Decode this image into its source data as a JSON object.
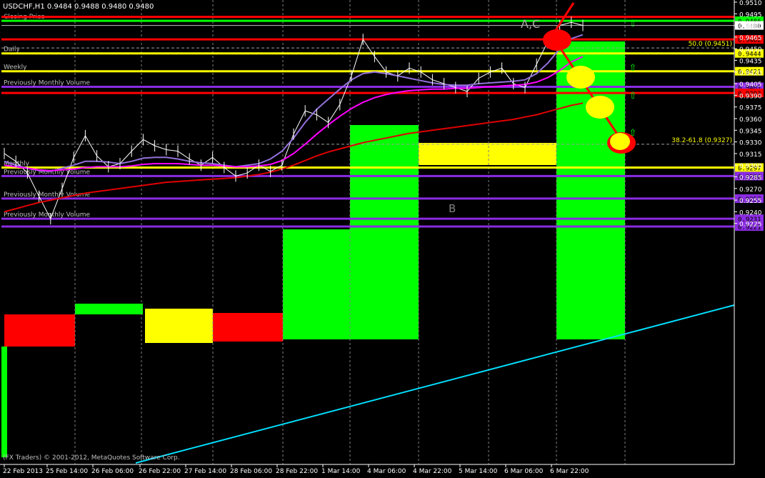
{
  "chart_data": {
    "type": "line",
    "title": "USDCHF,H1  0.9484 0.9488 0.9480 0.9480",
    "ylim": [
      0.921,
      0.951
    ],
    "y_ticks": [
      "0.9510",
      "0.9495",
      "0.9480",
      "0.9465",
      "0.9450",
      "0.9435",
      "0.9420",
      "0.9405",
      "0.9390",
      "0.9375",
      "0.9360",
      "0.9345",
      "0.9330",
      "0.9315",
      "0.9300",
      "0.9285",
      "0.9270",
      "0.9255",
      "0.9240",
      "0.9225"
    ],
    "x_ticks": [
      "22 Feb 2013",
      "25 Feb 14:00",
      "26 Feb 06:00",
      "26 Feb 22:00",
      "27 Feb 14:00",
      "28 Feb 06:00",
      "28 Feb 22:00",
      "1 Mar 14:00",
      "4 Mar 06:00",
      "4 Mar 22:00",
      "5 Mar 14:00",
      "6 Mar 06:00",
      "6 Mar 22:00"
    ],
    "horizontal_levels": [
      {
        "name": "Closing Price",
        "value": 0.9486,
        "label": "0.9486",
        "color": "#00ff00"
      },
      {
        "name": "",
        "value": 0.9491,
        "label": "",
        "color": "#ff0000"
      },
      {
        "name": "",
        "value": 0.948,
        "label": "0.9480",
        "color": "#c0c0c0"
      },
      {
        "name": "",
        "value": 0.9462,
        "label": "0.9462",
        "color": "#ff0000"
      },
      {
        "name": "Daily",
        "value": 0.9444,
        "label": "0.9444",
        "color": "#ffff00"
      },
      {
        "name": "Weekly",
        "value": 0.9421,
        "label": "0.9421",
        "color": "#ffff00"
      },
      {
        "name": "Previously Monthly Volume",
        "value": 0.9401,
        "label": "0.9401",
        "color": "#8a2be2"
      },
      {
        "name": "",
        "value": 0.9393,
        "label": "0.9393",
        "color": "#ff0000"
      },
      {
        "name": "Monthly",
        "value": 0.9297,
        "label": "0.9297",
        "color": "#ffff00"
      },
      {
        "name": "Previously Monthly Volume",
        "value": 0.9286,
        "label": "0.9286",
        "color": "#8a2be2"
      },
      {
        "name": "Previously Monthly Volume",
        "value": 0.9257,
        "label": "0.9257",
        "color": "#8a2be2"
      },
      {
        "name": "Previously Monthly Volume",
        "value": 0.9231,
        "label": "0.9231",
        "color": "#8a2be2"
      },
      {
        "name": "",
        "value": 0.9221,
        "label": "0.9221",
        "color": "#8a2be2"
      }
    ],
    "fib_levels": [
      {
        "label": "50.0 (0.9451)",
        "value": 0.9451
      },
      {
        "label": "38.2-61.8 (0.9327)",
        "value": 0.9327
      }
    ],
    "annotations": [
      "A,C",
      "B"
    ],
    "copyright": "(FX Traders) © 2001-2012, MetaQuotes Software Corp.",
    "series": [
      {
        "name": "",
        "color": "#ffffff",
        "values": [
          0.9315,
          0.9305,
          0.929,
          0.926,
          0.9231,
          0.927,
          0.931,
          0.9338,
          0.9312,
          0.9298,
          0.9302,
          0.9318,
          0.9333,
          0.9325,
          0.932,
          0.9318,
          0.9308,
          0.93,
          0.931,
          0.9297,
          0.9286,
          0.929,
          0.93,
          0.9292,
          0.93,
          0.934,
          0.937,
          0.9365,
          0.9355,
          0.9378,
          0.9415,
          0.9462,
          0.944,
          0.942,
          0.9415,
          0.9425,
          0.942,
          0.941,
          0.9405,
          0.94,
          0.9395,
          0.9412,
          0.942,
          0.9425,
          0.9405,
          0.94,
          0.943,
          0.946,
          0.948,
          0.9484,
          0.948
        ]
      },
      {
        "name": "",
        "color": "#9370db",
        "values": [
          0.9305,
          0.93,
          0.9296,
          0.9293,
          0.9292,
          0.9296,
          0.93,
          0.9305,
          0.9305,
          0.9304,
          0.9302,
          0.9305,
          0.9309,
          0.931,
          0.931,
          0.9308,
          0.9305,
          0.9303,
          0.9302,
          0.93,
          0.9298,
          0.93,
          0.9302,
          0.9308,
          0.9318,
          0.9335,
          0.9355,
          0.9372,
          0.9385,
          0.9398,
          0.941,
          0.9418,
          0.942,
          0.9418,
          0.9415,
          0.9412,
          0.9409,
          0.9406,
          0.9404,
          0.9403,
          0.9403,
          0.9405,
          0.9406,
          0.9407,
          0.9408,
          0.941,
          0.9418,
          0.9432,
          0.945,
          0.9463,
          0.9468
        ]
      },
      {
        "name": "",
        "color": "#ff00ff",
        "values": [
          0.93,
          0.9298,
          0.9296,
          0.9294,
          0.9293,
          0.9294,
          0.9295,
          0.9297,
          0.9298,
          0.9298,
          0.9298,
          0.9299,
          0.9301,
          0.9302,
          0.9302,
          0.9302,
          0.9301,
          0.93,
          0.93,
          0.9299,
          0.9298,
          0.9298,
          0.9299,
          0.9301,
          0.9306,
          0.9315,
          0.9327,
          0.934,
          0.9352,
          0.9363,
          0.9373,
          0.9381,
          0.9387,
          0.9391,
          0.9394,
          0.9396,
          0.9397,
          0.9398,
          0.9398,
          0.9399,
          0.9399,
          0.94,
          0.9401,
          0.9402,
          0.9403,
          0.9404,
          0.9407,
          0.9413,
          0.9422,
          0.9433,
          0.944
        ]
      },
      {
        "name": "",
        "color": "#e00000",
        "values": [
          0.924,
          0.9244,
          0.9248,
          0.9252,
          0.9255,
          0.9258,
          0.9261,
          0.9264,
          0.9266,
          0.9268,
          0.927,
          0.9272,
          0.9274,
          0.9276,
          0.9278,
          0.9279,
          0.928,
          0.9281,
          0.9282,
          0.9283,
          0.9284,
          0.9286,
          0.9288,
          0.9291,
          0.9295,
          0.93,
          0.9306,
          0.9312,
          0.9317,
          0.9321,
          0.9325,
          0.9329,
          0.9332,
          0.9335,
          0.9338,
          0.9341,
          0.9343,
          0.9345,
          0.9347,
          0.9349,
          0.9351,
          0.9353,
          0.9355,
          0.9357,
          0.9359,
          0.9362,
          0.9365,
          0.9369,
          0.9373,
          0.9377,
          0.938
        ]
      }
    ]
  }
}
